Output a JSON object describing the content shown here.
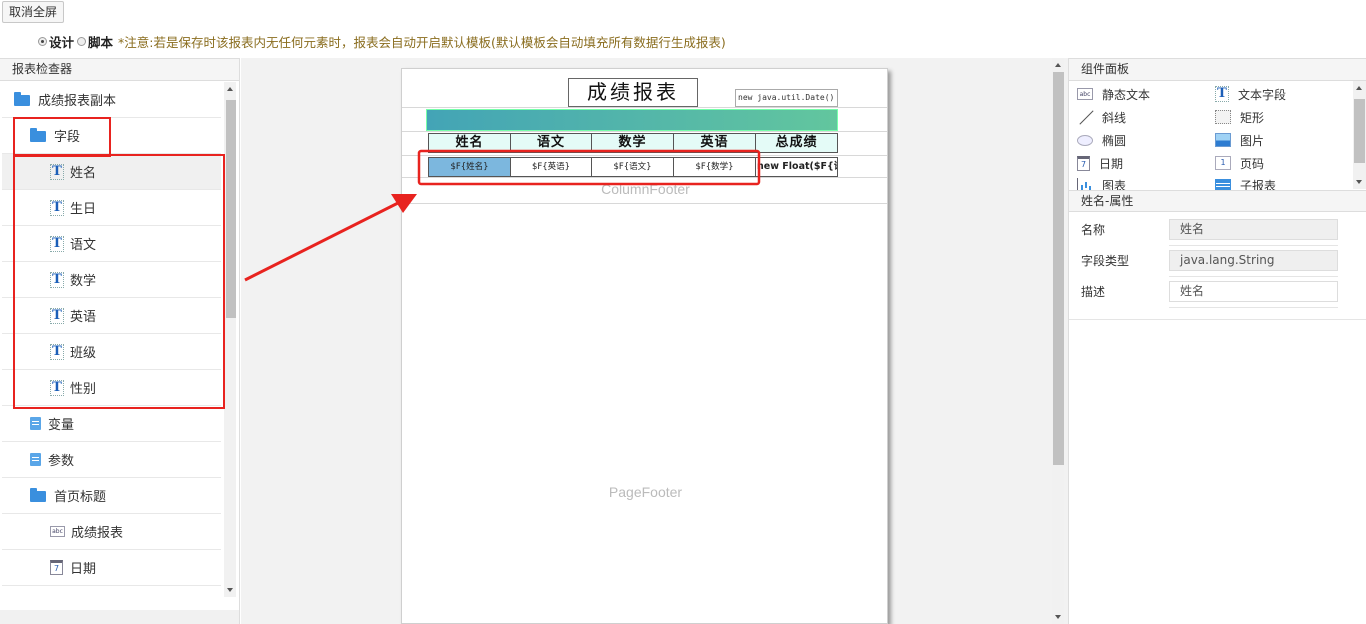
{
  "toolbar": {
    "exit_fullscreen_label": "取消全屏",
    "mode_design_label": "设计",
    "mode_script_label": "脚本",
    "note": "*注意:若是保存时该报表内无任何元素时，报表会自动开启默认模板(默认模板会自动填充所有数据行生成报表)"
  },
  "inspector": {
    "title": "报表检查器",
    "items": [
      {
        "label": "成绩报表副本",
        "icon": "folder-icon"
      },
      {
        "label": "字段",
        "icon": "folder-icon"
      },
      {
        "label": "姓名",
        "icon": "text-field-icon"
      },
      {
        "label": "生日",
        "icon": "text-field-icon"
      },
      {
        "label": "语文",
        "icon": "text-field-icon"
      },
      {
        "label": "数学",
        "icon": "text-field-icon"
      },
      {
        "label": "英语",
        "icon": "text-field-icon"
      },
      {
        "label": "班级",
        "icon": "text-field-icon"
      },
      {
        "label": "性别",
        "icon": "text-field-icon"
      },
      {
        "label": "变量",
        "icon": "document-icon"
      },
      {
        "label": "参数",
        "icon": "document-icon"
      },
      {
        "label": "首页标题",
        "icon": "folder-icon"
      },
      {
        "label": "成绩报表",
        "icon": "static-text-icon"
      },
      {
        "label": "日期",
        "icon": "calendar-icon"
      }
    ]
  },
  "report": {
    "title": "成绩报表",
    "date_expression": "new java.util.Date()",
    "headers": [
      "姓名",
      "语文",
      "数学",
      "英语",
      "总成绩"
    ],
    "details": [
      "$F{姓名}",
      "$F{英语}",
      "$F{语文}",
      "$F{数学}",
      "new Float($F{语"
    ],
    "column_footer_label": "ColumnFooter",
    "page_footer_label": "PageFooter",
    "accent_gradient": [
      "#43a4b6",
      "#62c69e"
    ],
    "selected_cell_color": "#7cb7de"
  },
  "components": {
    "title": "组件面板",
    "items": [
      {
        "label": "静态文本",
        "icon": "static-text-icon"
      },
      {
        "label": "文本字段",
        "icon": "text-field-icon"
      },
      {
        "label": "斜线",
        "icon": "line-icon"
      },
      {
        "label": "矩形",
        "icon": "rectangle-icon"
      },
      {
        "label": "椭圆",
        "icon": "ellipse-icon"
      },
      {
        "label": "图片",
        "icon": "image-icon"
      },
      {
        "label": "日期",
        "icon": "calendar-icon"
      },
      {
        "label": "页码",
        "icon": "page-number-icon"
      },
      {
        "label": "图表",
        "icon": "chart-icon"
      },
      {
        "label": "子报表",
        "icon": "subreport-icon"
      }
    ]
  },
  "properties": {
    "title": "姓名-属性",
    "name_label": "名称",
    "name_value": "姓名",
    "type_label": "字段类型",
    "type_value": "java.lang.String",
    "desc_label": "描述",
    "desc_value": "姓名"
  },
  "annotation": {
    "highlight_color": "#e8231f"
  }
}
